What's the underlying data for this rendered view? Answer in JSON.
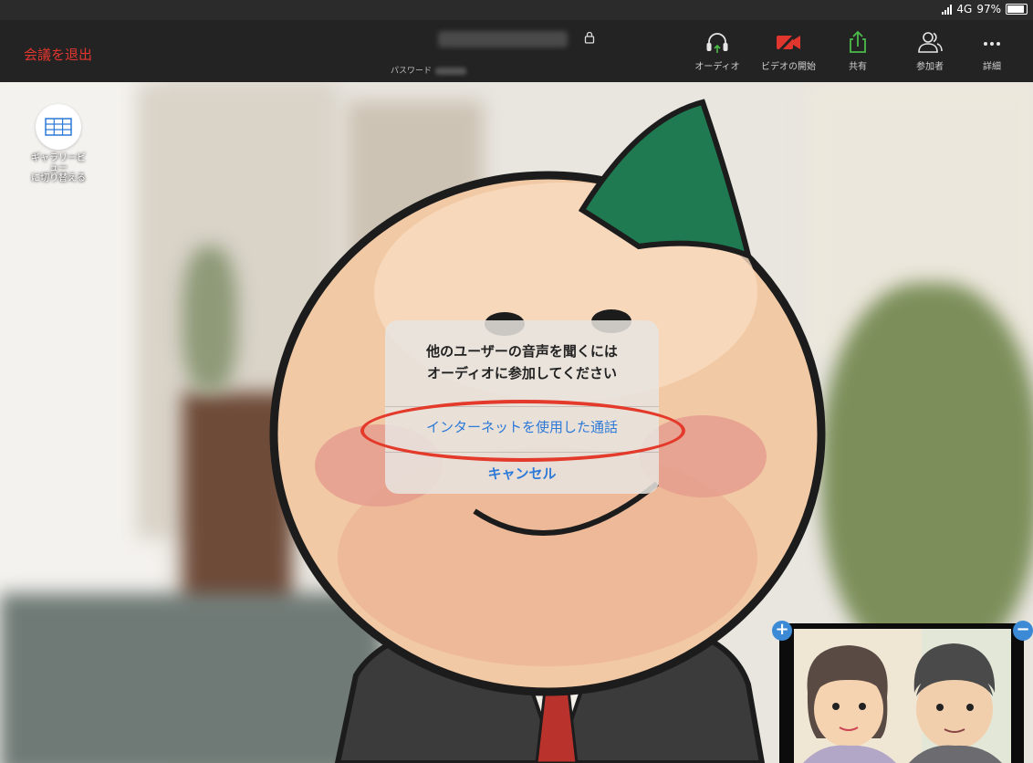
{
  "status_bar": {
    "network": "4G",
    "battery": "97%"
  },
  "toolbar": {
    "leave": "会議を退出",
    "password_label": "パスワード",
    "buttons": [
      {
        "label": "オーディオ",
        "icon": "headphones-icon"
      },
      {
        "label": "ビデオの開始",
        "icon": "video-off-icon"
      },
      {
        "label": "共有",
        "icon": "share-icon"
      },
      {
        "label": "参加者",
        "icon": "participants-icon"
      },
      {
        "label": "詳細",
        "icon": "more-icon"
      }
    ]
  },
  "gallery": {
    "label_line1": "ギャラリービ",
    "label_line2": "ュー",
    "label_line3": "に切り替える"
  },
  "dialog": {
    "title_line1": "他のユーザーの音声を聞くには",
    "title_line2": "オーディオに参加してください",
    "option_internet": "インターネットを使用した通話",
    "option_cancel": "キャンセル"
  },
  "thumbnail": {
    "plus": "+",
    "minus": "−"
  },
  "colors": {
    "accent_red": "#e0362e",
    "link_blue": "#2d79d8",
    "share_green": "#4cbb4a",
    "highlight_red": "#e33a2b"
  }
}
